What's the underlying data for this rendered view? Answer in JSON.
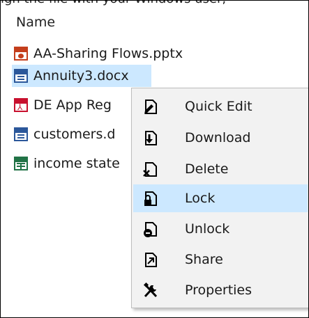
{
  "top_text": "ign the file with your Windows user,",
  "column_header": "Name",
  "files": [
    {
      "name": "AA-Sharing Flows.pptx",
      "icon": "powerpoint-file-icon",
      "selected": false
    },
    {
      "name": "Annuity3.docx",
      "icon": "word-file-icon",
      "selected": true
    },
    {
      "name": "DE App  Reg",
      "icon": "pdf-file-icon",
      "selected": false
    },
    {
      "name": "customers.d",
      "icon": "word-file-icon",
      "selected": false
    },
    {
      "name": "income state",
      "icon": "excel-file-icon",
      "selected": false
    }
  ],
  "context_menu": {
    "items": [
      {
        "label": "Quick Edit",
        "icon": "quick-edit-icon"
      },
      {
        "label": "Download",
        "icon": "download-icon"
      },
      {
        "label": "Delete",
        "icon": "delete-icon"
      },
      {
        "label": "Lock",
        "icon": "lock-icon",
        "highlighted": true
      },
      {
        "label": "Unlock",
        "icon": "unlock-icon"
      },
      {
        "label": "Share",
        "icon": "share-icon"
      },
      {
        "label": "Properties",
        "icon": "properties-icon"
      }
    ]
  },
  "colors": {
    "selection": "#cce8ff",
    "menu_background": "#f2f2f2",
    "word": "#2b579a",
    "powerpoint": "#c43e1c",
    "pdf": "#c8102e",
    "excel": "#217346"
  }
}
